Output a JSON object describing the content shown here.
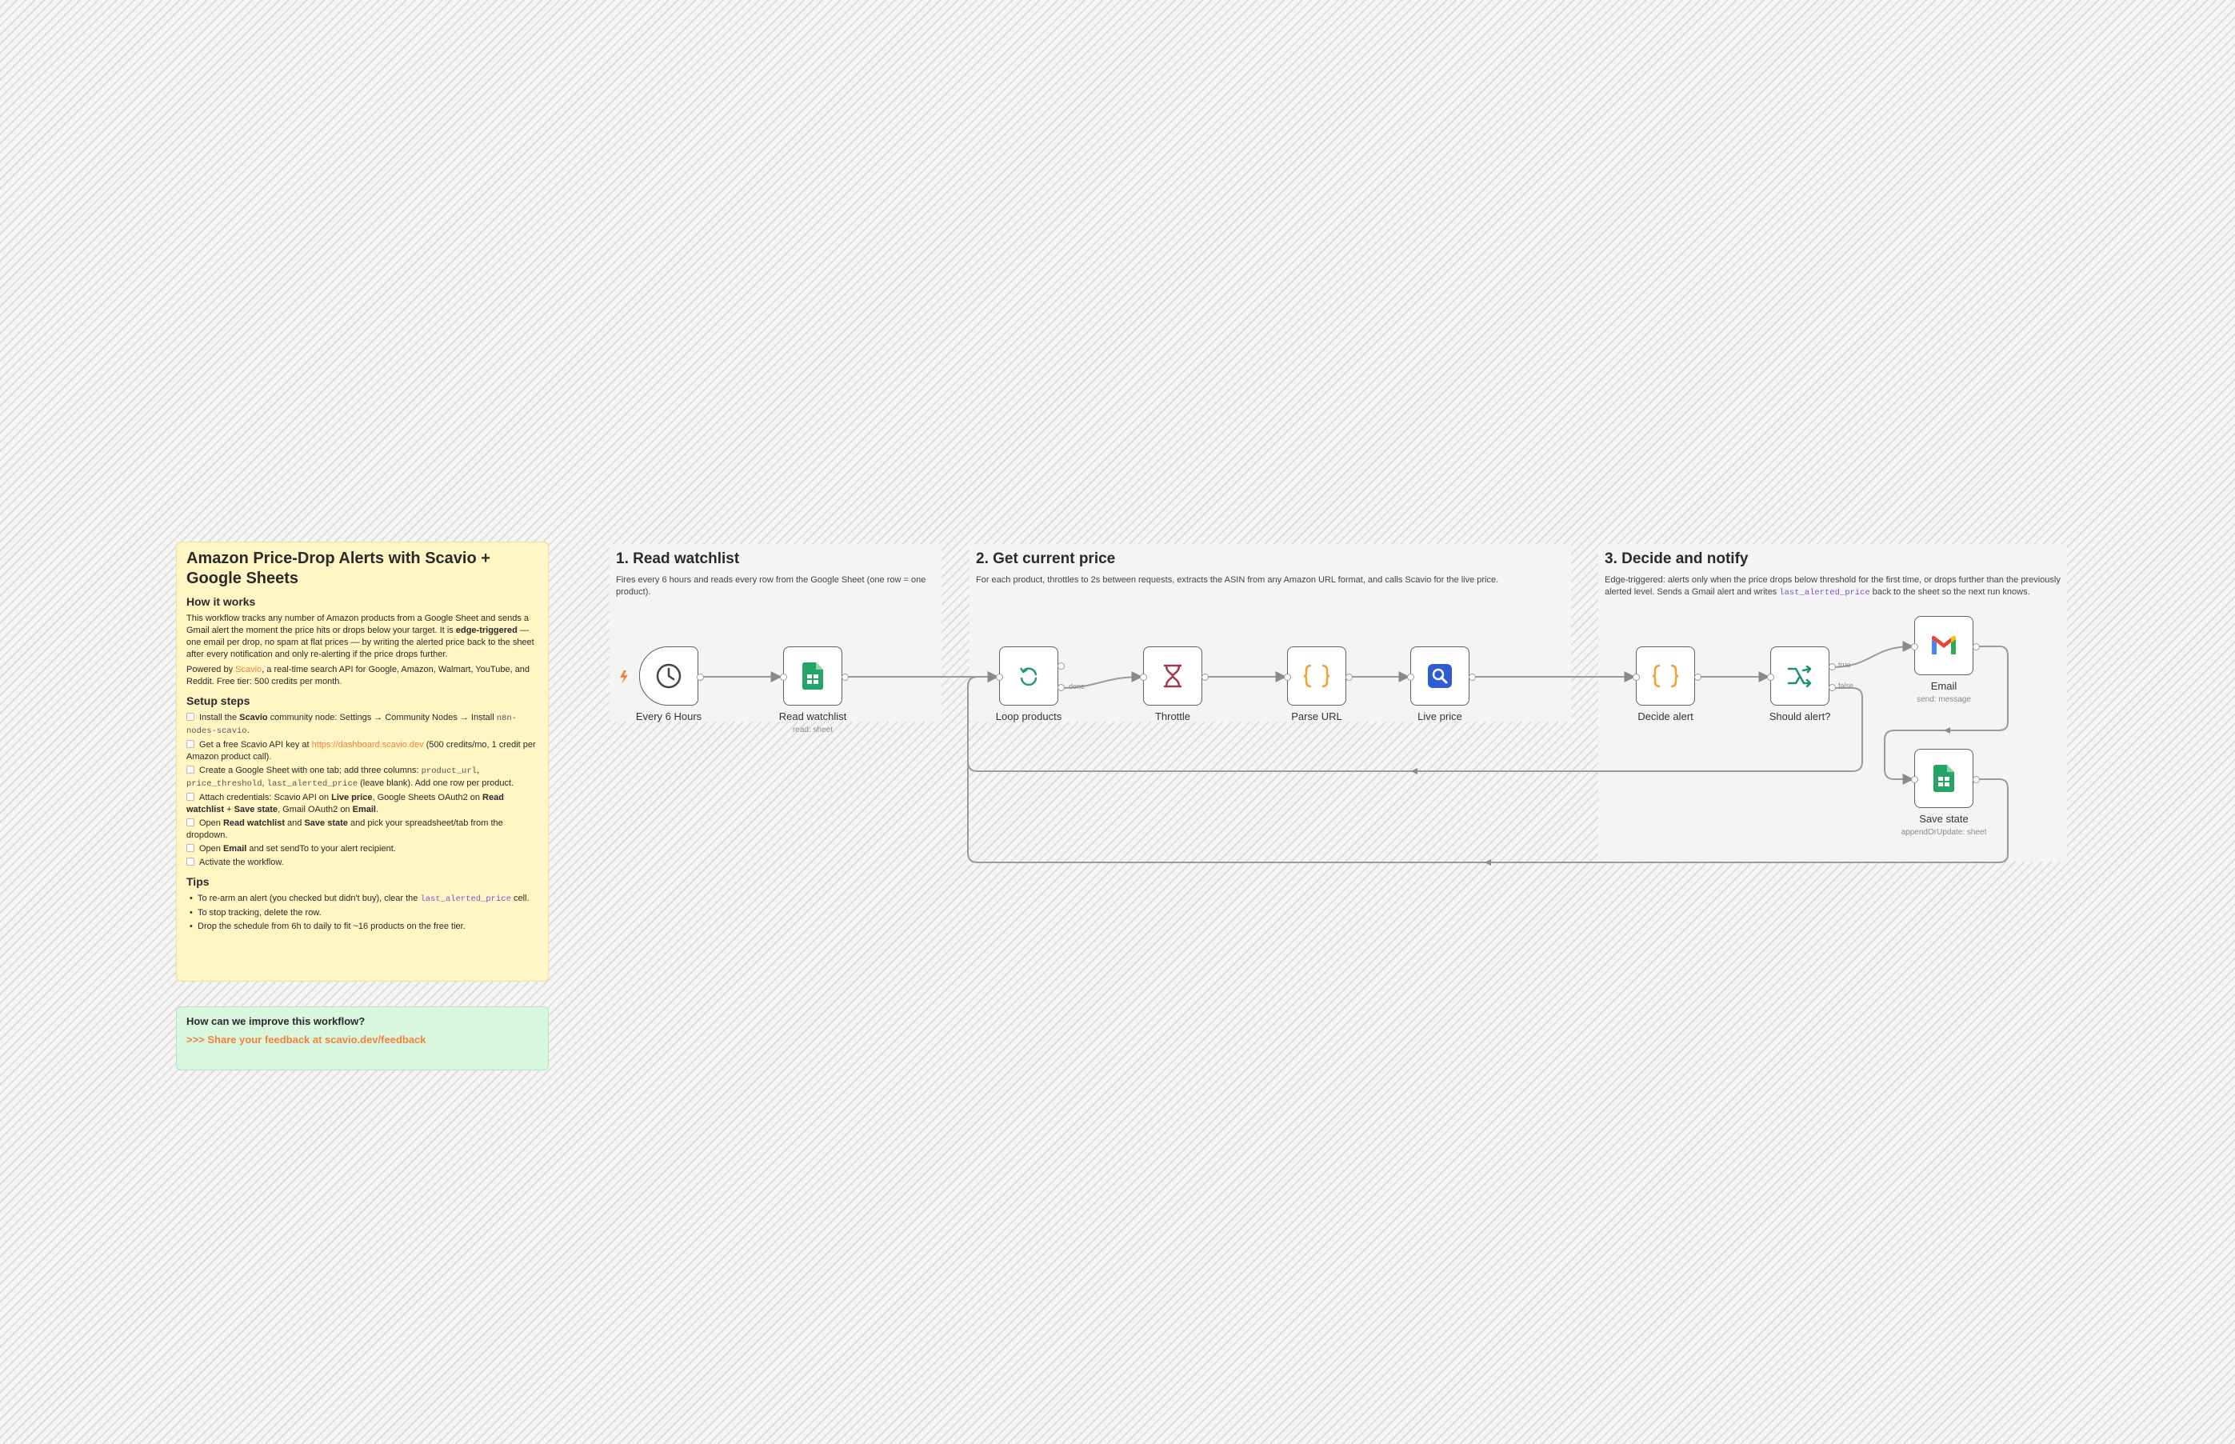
{
  "notes": {
    "main": {
      "title": "Amazon Price-Drop Alerts with Scavio + Google Sheets",
      "how_heading": "How it works",
      "how_text": {
        "a": "This workflow tracks any number of Amazon products from a Google Sheet and sends a Gmail alert the moment the price hits or drops below your target. It is ",
        "b": "edge-triggered",
        "c": " — one email per drop, no spam at flat prices — by writing the alerted price back to the sheet after every notification and only re-alerting if the price drops further."
      },
      "powered": {
        "a": "Powered by ",
        "link": "Scavio",
        "b": ", a real-time search API for Google, Amazon, Walmart, YouTube, and Reddit. Free tier: 500 credits per month."
      },
      "setup_heading": "Setup steps",
      "steps": {
        "s1": {
          "a": "Install the ",
          "b": "Scavio",
          "c": " community node: Settings → Community Nodes → Install ",
          "code": "n8n-nodes-scavio",
          "d": "."
        },
        "s2": {
          "a": "Get a free Scavio API key at ",
          "link": "https://dashboard.scavio.dev",
          "b": " (500 credits/mo, 1 credit per Amazon product call)."
        },
        "s3": {
          "a": "Create a Google Sheet with one tab; add three columns: ",
          "c1": "product_url",
          "sep1": ", ",
          "c2": "price_threshold",
          "sep2": ", ",
          "c3": "last_alerted_price",
          "b": " (leave blank). Add one row per product."
        },
        "s4": {
          "a": "Attach credentials: Scavio API on ",
          "b1": "Live price",
          "c": ", Google Sheets OAuth2 on ",
          "b2": "Read watchlist",
          "d": " + ",
          "b3": "Save state",
          "e": ", Gmail OAuth2 on ",
          "b4": "Email",
          "f": "."
        },
        "s5": {
          "a": "Open ",
          "b1": "Read watchlist",
          "c": " and ",
          "b2": "Save state",
          "d": " and pick your spreadsheet/tab from the dropdown."
        },
        "s6": {
          "a": "Open ",
          "b": "Email",
          "c": " and set sendTo to your alert recipient."
        },
        "s7": {
          "a": "Activate the workflow."
        }
      },
      "tips_heading": "Tips",
      "tips": {
        "t1": {
          "a": "To re-arm an alert (you checked but didn't buy), clear the ",
          "code": "last_alerted_price",
          "b": " cell."
        },
        "t2": "To stop tracking, delete the row.",
        "t3": "Drop the schedule from 6h to daily to fit ~16 products on the free tier."
      }
    },
    "feedback": {
      "title": "How can we improve this workflow?",
      "link": ">>> Share your feedback at scavio.dev/feedback"
    }
  },
  "groups": {
    "g1": {
      "title": "1. Read watchlist",
      "desc": "Fires every 6 hours and reads every row from the Google Sheet (one row = one product)."
    },
    "g2": {
      "title": "2. Get current price",
      "desc": "For each product, throttles to 2s between requests, extracts the ASIN from any Amazon URL format, and calls Scavio for the live price."
    },
    "g3": {
      "title": "3. Decide and notify",
      "desc_a": "Edge-triggered: alerts only when the price drops below threshold for the first time, or drops further than the previously alerted level. Sends a Gmail alert and writes ",
      "desc_code": "last_alerted_price",
      "desc_b": " back to the sheet so the next run knows."
    }
  },
  "nodes": {
    "schedule": {
      "label": "Every 6 Hours",
      "icon": "clock-icon"
    },
    "read": {
      "label": "Read watchlist",
      "sub": "read: sheet",
      "icon": "google-sheets-icon"
    },
    "loop": {
      "label": "Loop products",
      "icon": "loop-icon",
      "branch_done": "done"
    },
    "throttle": {
      "label": "Throttle",
      "icon": "hourglass-icon"
    },
    "parse": {
      "label": "Parse URL",
      "icon": "code-braces-icon"
    },
    "live": {
      "label": "Live price",
      "icon": "scavio-search-icon"
    },
    "decide": {
      "label": "Decide alert",
      "icon": "code-braces-icon"
    },
    "should": {
      "label": "Should alert?",
      "icon": "if-branch-icon",
      "branch_true": "true",
      "branch_false": "false"
    },
    "email": {
      "label": "Email",
      "sub": "send: message",
      "icon": "gmail-icon"
    },
    "save": {
      "label": "Save state",
      "sub": "appendOrUpdate: sheet",
      "icon": "google-sheets-icon"
    }
  },
  "colors": {
    "note_yellow": "#fff6c4",
    "note_green": "#d9f6de",
    "accent_orange": "#f5803e",
    "wire": "#9a9a9a",
    "node_border": "#5f5f5f"
  }
}
